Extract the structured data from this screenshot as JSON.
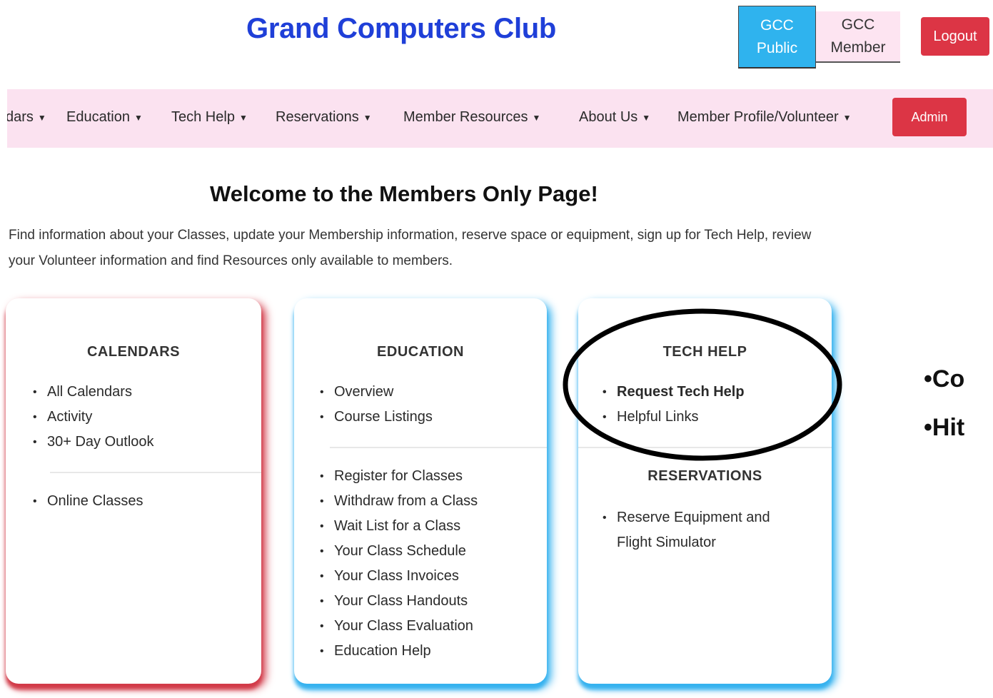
{
  "header": {
    "site_title": "Grand Computers Club",
    "toggle_public": [
      "GCC",
      "Public"
    ],
    "toggle_member": [
      "GCC",
      "Member"
    ],
    "logout_label": "Logout"
  },
  "nav": {
    "items": [
      "dars",
      "Education",
      "Tech Help",
      "Reservations",
      "Member Resources",
      "About Us",
      "Member Profile/Volunteer"
    ],
    "admin_label": "Admin"
  },
  "main": {
    "welcome_title": "Welcome to the Members Only Page!",
    "intro_text": "Find information about your Classes, update your Membership information, reserve space or equipment, sign up for Tech Help, review your Volunteer information and find Resources only available to members."
  },
  "cards": {
    "calendars": {
      "title": "CALENDARS",
      "items": [
        "All Calendars",
        "Activity",
        "30+ Day Outlook"
      ],
      "items2": [
        "Online Classes"
      ]
    },
    "education": {
      "title": "EDUCATION",
      "items": [
        "Overview",
        "Course Listings"
      ],
      "items2": [
        "Register for Classes",
        "Withdraw from a Class",
        "Wait List for a Class",
        "Your Class Schedule",
        "Your Class Invoices",
        "Your Class Handouts",
        "Your Class Evaluation",
        "Education Help"
      ]
    },
    "tech_help": {
      "title": "TECH HELP",
      "items": [
        "Request Tech Help",
        "Helpful Links"
      ],
      "reservations_title": "RESERVATIONS",
      "reservations_items": [
        "Reserve Equipment and Flight Simulator"
      ]
    }
  },
  "side_text": [
    "•Co",
    "•Hit"
  ],
  "colors": {
    "title_blue": "#1f3fd8",
    "public_blue": "#2fb3ee",
    "nav_pink": "#fbe2f0",
    "button_red": "#dc3545",
    "shadow_red": "#d23a48",
    "shadow_blue": "#36b2ef"
  }
}
